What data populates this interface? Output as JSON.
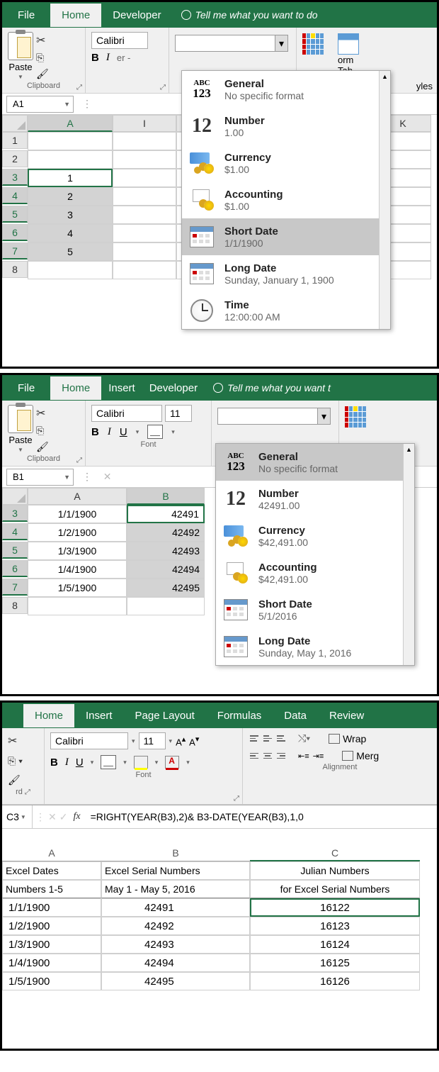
{
  "panel1": {
    "tabs": {
      "file": "File",
      "home": "Home",
      "developer": "Developer",
      "tell": "Tell me what you want to do"
    },
    "clipboard": {
      "paste": "Paste",
      "label": "Clipboard"
    },
    "font": {
      "name": "Calibri",
      "bold": "B",
      "italic": "I",
      "er": "er",
      "dash": "-"
    },
    "numfmt_combo": "",
    "right": {
      "orm": "orm",
      "tab": "Tab",
      "yles": "yles"
    },
    "namebox": "A1",
    "cols": [
      "A",
      "I",
      "K"
    ],
    "rows": [
      "1",
      "2",
      "3",
      "4",
      "5",
      "6",
      "7",
      "8"
    ],
    "vals": {
      "3": "1",
      "4": "2",
      "5": "3",
      "6": "4",
      "7": "5"
    },
    "dd": [
      {
        "id": "general",
        "icon": "abc",
        "t1": "General",
        "t2": "No specific format"
      },
      {
        "id": "number",
        "icon": "12",
        "t1": "Number",
        "t2": "1.00"
      },
      {
        "id": "currency",
        "icon": "cur",
        "t1": "Currency",
        "t2": "$1.00"
      },
      {
        "id": "accounting",
        "icon": "acc",
        "t1": "Accounting",
        "t2": " $1.00"
      },
      {
        "id": "shortdate",
        "icon": "cal",
        "t1": "Short Date",
        "t2": "1/1/1900",
        "hover": true
      },
      {
        "id": "longdate",
        "icon": "cal",
        "t1": "Long Date",
        "t2": "Sunday, January 1, 1900"
      },
      {
        "id": "time",
        "icon": "clock",
        "t1": "Time",
        "t2": "12:00:00 AM"
      }
    ]
  },
  "panel2": {
    "tabs": {
      "file": "File",
      "home": "Home",
      "insert": "Insert",
      "developer": "Developer",
      "tell": "Tell me what you want t"
    },
    "clipboard": {
      "paste": "Paste",
      "label": "Clipboard"
    },
    "font": {
      "name": "Calibri",
      "size": "11",
      "label": "Font"
    },
    "namebox": "B1",
    "cols": [
      "A",
      "B"
    ],
    "rows": [
      "3",
      "4",
      "5",
      "6",
      "7",
      "8"
    ],
    "data": {
      "A": [
        "1/1/1900",
        "1/2/1900",
        "1/3/1900",
        "1/4/1900",
        "1/5/1900",
        ""
      ],
      "B": [
        "42491",
        "42492",
        "42493",
        "42494",
        "42495",
        ""
      ]
    },
    "dd": [
      {
        "id": "general",
        "icon": "abc",
        "t1": "General",
        "t2": "No specific format",
        "hover": true
      },
      {
        "id": "number",
        "icon": "12",
        "t1": "Number",
        "t2": "42491.00"
      },
      {
        "id": "currency",
        "icon": "cur",
        "t1": "Currency",
        "t2": "$42,491.00"
      },
      {
        "id": "accounting",
        "icon": "acc",
        "t1": "Accounting",
        "t2": " $42,491.00"
      },
      {
        "id": "shortdate",
        "icon": "cal",
        "t1": "Short Date",
        "t2": "5/1/2016"
      },
      {
        "id": "longdate",
        "icon": "cal",
        "t1": "Long Date",
        "t2": "Sunday, May 1, 2016"
      }
    ]
  },
  "panel3": {
    "tabs": {
      "home": "Home",
      "insert": "Insert",
      "layout": "Page Layout",
      "formulas": "Formulas",
      "data": "Data",
      "review": "Review"
    },
    "rd": "rd",
    "font": {
      "name": "Calibri",
      "size": "11",
      "label": "Font"
    },
    "align": {
      "label": "Alignment",
      "wrap": "Wrap",
      "merge": "Merg"
    },
    "cellref": "C3",
    "formula": "=RIGHT(YEAR(B3),2)& B3-DATE(YEAR(B3),1,0",
    "cols": [
      "A",
      "B",
      "C"
    ],
    "headers1": [
      "Excel Dates",
      "Excel Serial Numbers",
      "Julian Numbers"
    ],
    "headers2": [
      "Numbers 1-5",
      "May 1 - May 5, 2016",
      "for Excel Serial Numbers"
    ],
    "rows": [
      [
        "1/1/1900",
        "42491",
        "16122"
      ],
      [
        "1/2/1900",
        "42492",
        "16123"
      ],
      [
        "1/3/1900",
        "42493",
        "16124"
      ],
      [
        "1/4/1900",
        "42494",
        "16125"
      ],
      [
        "1/5/1900",
        "42495",
        "16126"
      ]
    ]
  }
}
